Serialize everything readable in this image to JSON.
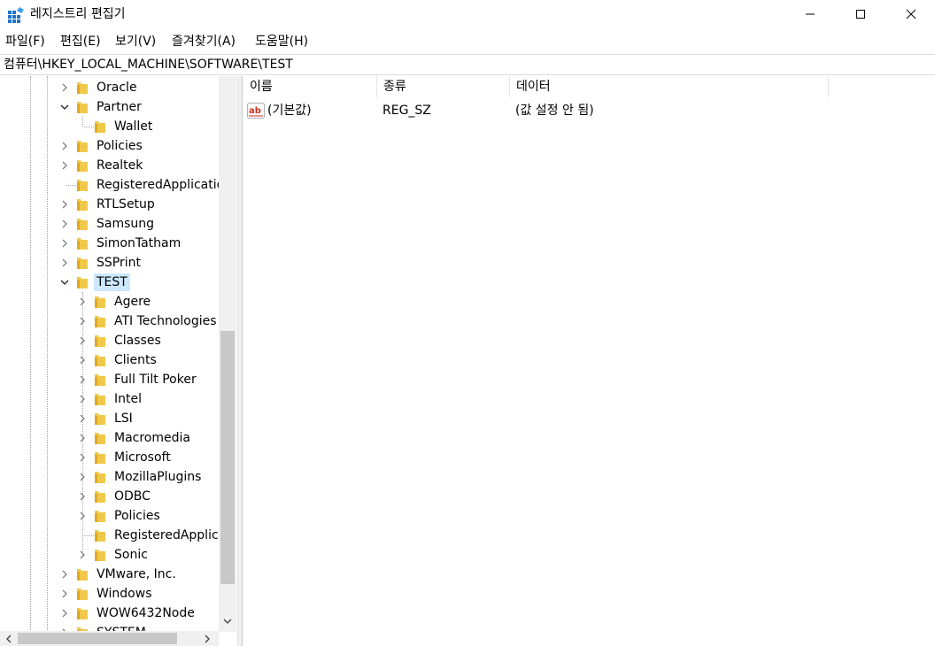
{
  "window": {
    "title": "레지스트리 편집기"
  },
  "menu": [
    "파일(F)",
    "편집(E)",
    "보기(V)",
    "즐겨찾기(A)",
    "도움말(H)"
  ],
  "address": "컴퓨터\\HKEY_LOCAL_MACHINE\\SOFTWARE\\TEST",
  "tree": {
    "level1": [
      {
        "label": "Oracle",
        "expander": "collapsed"
      },
      {
        "label": "Partner",
        "expander": "expanded"
      },
      {
        "label": "Policies",
        "expander": "collapsed"
      },
      {
        "label": "Realtek",
        "expander": "collapsed"
      },
      {
        "label": "RegisteredApplicatic",
        "expander": "none"
      },
      {
        "label": "RTLSetup",
        "expander": "collapsed"
      },
      {
        "label": "Samsung",
        "expander": "collapsed"
      },
      {
        "label": "SimonTatham",
        "expander": "collapsed"
      },
      {
        "label": "SSPrint",
        "expander": "collapsed"
      },
      {
        "label": "TEST",
        "expander": "expanded",
        "selected": true
      },
      {
        "label": "VMware, Inc.",
        "expander": "collapsed"
      },
      {
        "label": "Windows",
        "expander": "collapsed"
      },
      {
        "label": "WOW6432Node",
        "expander": "collapsed"
      },
      {
        "label": "SYSTEM",
        "expander": "collapsed"
      }
    ],
    "partner_children": [
      {
        "label": "Wallet",
        "expander": "none"
      }
    ],
    "test_children": [
      {
        "label": "Agere",
        "expander": "collapsed"
      },
      {
        "label": "ATI Technologies",
        "expander": "collapsed"
      },
      {
        "label": "Classes",
        "expander": "collapsed"
      },
      {
        "label": "Clients",
        "expander": "collapsed"
      },
      {
        "label": "Full Tilt Poker",
        "expander": "collapsed"
      },
      {
        "label": "Intel",
        "expander": "collapsed"
      },
      {
        "label": "LSI",
        "expander": "collapsed"
      },
      {
        "label": "Macromedia",
        "expander": "collapsed"
      },
      {
        "label": "Microsoft",
        "expander": "collapsed"
      },
      {
        "label": "MozillaPlugins",
        "expander": "collapsed"
      },
      {
        "label": "ODBC",
        "expander": "collapsed"
      },
      {
        "label": "Policies",
        "expander": "collapsed"
      },
      {
        "label": "RegisteredApplica",
        "expander": "none"
      },
      {
        "label": "Sonic",
        "expander": "collapsed"
      }
    ]
  },
  "list": {
    "columns": [
      "이름",
      "종류",
      "데이터"
    ],
    "rows": [
      {
        "name": "(기본값)",
        "type": "REG_SZ",
        "data": "(값 설정 안 됨)",
        "icon": "string-value-icon"
      }
    ]
  },
  "colors": {
    "selection": "#cce8ff",
    "folder": "#f0c84a",
    "scroll_thumb": "#c8c8c8"
  }
}
